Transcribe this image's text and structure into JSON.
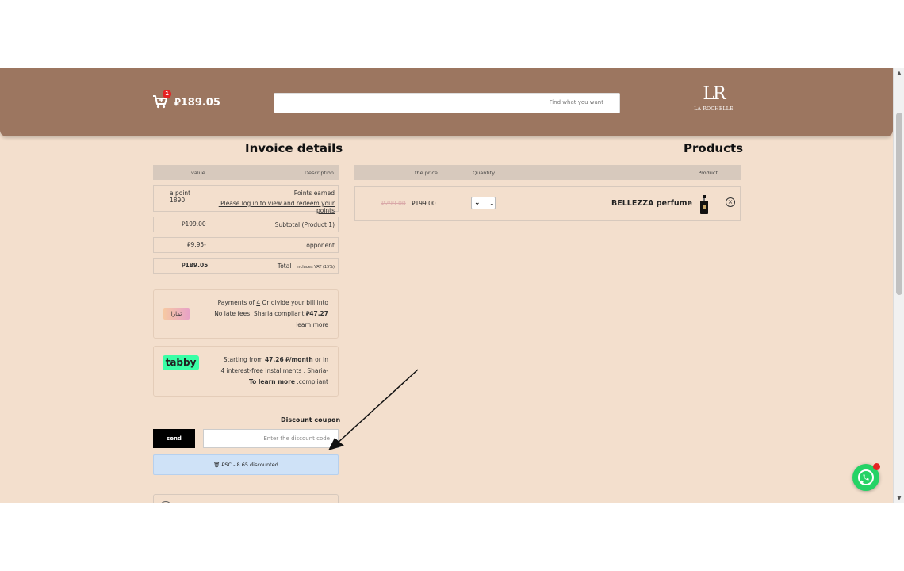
{
  "header": {
    "cart_count": "1",
    "cart_total": "⃁189.05",
    "search_placeholder": "Find what you want",
    "logo_text": "LA ROCHELLE",
    "logo_monogram": "LR"
  },
  "invoice": {
    "title": "Invoice details",
    "col_value": "value",
    "col_description": "Description",
    "points_value": "a point 1890",
    "points_label": "Points earned",
    "points_link": ".Please log in to view and redeem your points",
    "subtotal_value": "⃁199.00",
    "subtotal_label": "Subtotal (Product 1)",
    "opponent_value": "⃁9.95-",
    "opponent_label": "opponent",
    "total_value": "⃁189.05",
    "total_label": "Total",
    "total_note": "Includes VAT (15%)"
  },
  "tamara": {
    "logo_text": "تمارا",
    "line1_pre": "Payments of ",
    "line1_num": "4",
    "line1_post": " Or divide your bill into",
    "line2_pre": "No late fees, Sharia compliant ",
    "line2_amount": "⃁47.27",
    "link": "learn more"
  },
  "tabby": {
    "logo_text": "tabby",
    "line1_pre": "Starting from ",
    "line1_amount": "47.26 ⃁/month",
    "line1_post": " or in",
    "line2": "4 interest-free installments . Sharia-",
    "line3_bold": "To learn more",
    "line3_post": " .compliant"
  },
  "coupon": {
    "title": "Discount coupon",
    "send_label": "send",
    "input_placeholder": "Enter the discount code",
    "applied": "⃁SC - 8.65 discounted"
  },
  "products": {
    "title": "Products",
    "col_price": "the price",
    "col_quantity": "Quantity",
    "col_product": "Product",
    "old_price": "⃁299.00",
    "price": "⃁199.00",
    "quantity": "1",
    "name": "BELLEZZA perfume"
  }
}
